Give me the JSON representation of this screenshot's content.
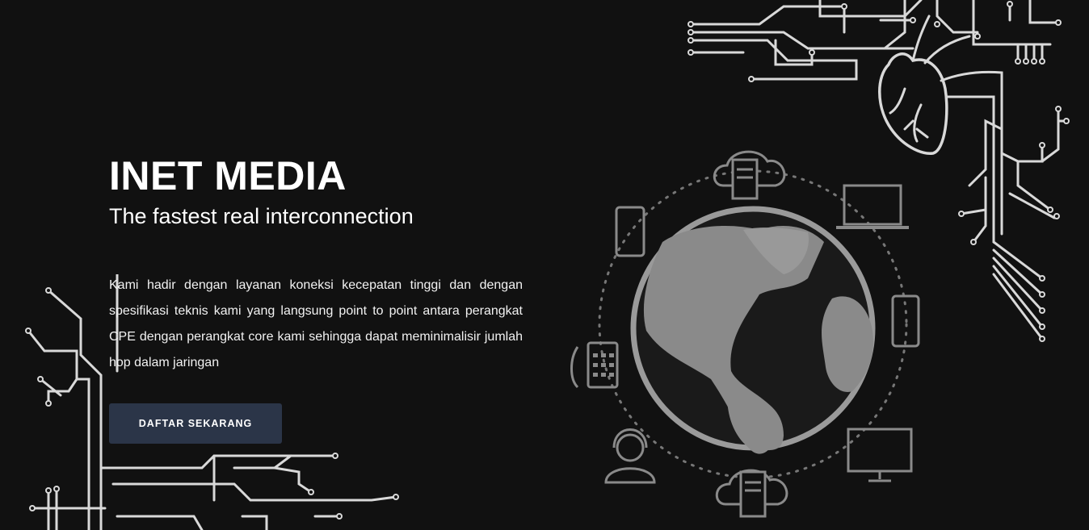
{
  "hero": {
    "title": "INET MEDIA",
    "subtitle": "The fastest real interconnection",
    "description": "Kami hadir dengan layanan koneksi kecepatan tinggi dan dengan spesifikasi teknis kami yang langsung point to point antara perangkat CPE dengan perangkat core kami sehingga dapat meminimalisir jumlah hop dalam jaringan",
    "cta_label": "DAFTAR SEKARANG"
  },
  "theme": {
    "background": "#111111",
    "button_bg": "#2b3548",
    "circuit_color": "#d9d9d9",
    "network_icon_color": "#8a8a8a"
  },
  "icons": [
    "circuit-heart-icon",
    "circuit-lines-icon",
    "globe-icon",
    "cloud-server-icon",
    "laptop-icon",
    "tablet-icon",
    "monitor-icon",
    "headset-agent-icon",
    "phone-icon",
    "smartphone-icon"
  ]
}
